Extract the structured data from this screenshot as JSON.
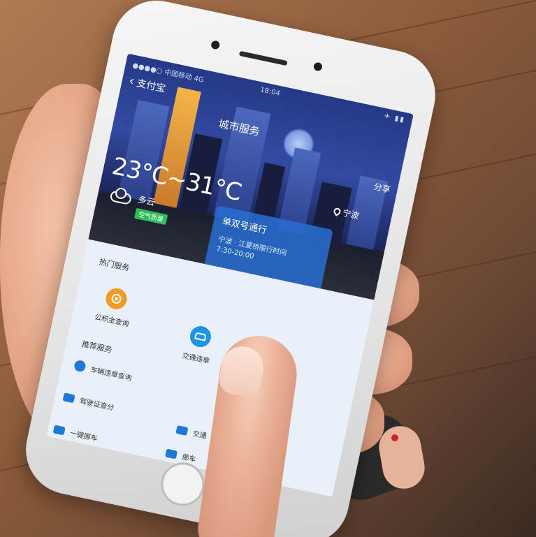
{
  "status_bar": {
    "carrier": "●●●●○ 中国移动 4G",
    "time": "18:04",
    "icons": "✈ ▮▮"
  },
  "nav": {
    "back_label": "支付宝",
    "title": "城市服务",
    "share_label": "分享"
  },
  "location": "宁波",
  "weather": {
    "temperature": "23°C~31°C",
    "condition": "多云",
    "aqi": "空气质量"
  },
  "restriction": {
    "title": "单双号通行",
    "detail_line1": "宁波 · 江夏桥限行时间",
    "detail_line2": "7:30-20:00"
  },
  "services": {
    "popular_title": "热门服务",
    "items": [
      {
        "label": "公积金查询",
        "icon": "coin-icon"
      },
      {
        "label": "交通违章",
        "icon": "car-icon"
      },
      {
        "label": "",
        "icon": "car-icon"
      }
    ],
    "recommended_title": "推荐服务",
    "list": [
      {
        "label": "车辆违章查询",
        "icon": "car-icon"
      },
      {
        "label": "驾驶证查分",
        "icon": "card-icon"
      },
      {
        "label": "交通",
        "icon": "car-icon"
      },
      {
        "label": "一键挪车",
        "icon": "car-icon"
      },
      {
        "label": "挪车",
        "icon": "car-icon"
      }
    ]
  },
  "colors": {
    "hero_top": "#243a86",
    "restriction_card": "#286ed2",
    "icon_orange": "#f19a25",
    "icon_blue": "#1e94e4",
    "icon_teal": "#15b08c",
    "aqi_green": "#2ec05a"
  }
}
